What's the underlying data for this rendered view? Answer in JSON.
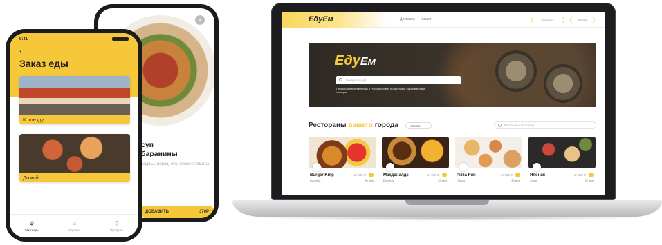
{
  "phone_front": {
    "time": "9:41",
    "back_glyph": "‹",
    "title": "Заказ еды",
    "tiles": [
      {
        "label": "К поезду"
      },
      {
        "label": "Домой"
      }
    ],
    "tabs": [
      {
        "icon": "fork-knife-icon",
        "glyph": "ψ",
        "label": "Заказ еды"
      },
      {
        "icon": "bag-icon",
        "glyph": "⌂",
        "label": "Корзина"
      },
      {
        "icon": "profile-icon",
        "glyph": "⚲",
        "label": "Профиль"
      }
    ]
  },
  "phone_back": {
    "close_glyph": "×",
    "dish_title": "суп\nбаранины",
    "dish_desc": "огурцы, перец, лук, спелые томаты",
    "add_label": "ДОБАВИТЬ",
    "add_price": "370Р"
  },
  "laptop": {
    "logo": "EдуЕм",
    "nav": [
      "Доставка",
      "Акции"
    ],
    "head_buttons": [
      "Корзина",
      "Войти"
    ],
    "hero": {
      "logo_main": "Eду",
      "logo_tail": "Ем",
      "search_placeholder": "Номер поезда",
      "subtitle": "Первый и единственный в России сервис по доставке еды к вагонам поездов"
    },
    "section": {
      "title_start": "Рестораны ",
      "title_accent": "вашего",
      "title_end": " города",
      "city": "Москва",
      "search_placeholder": "Ресторан или блюдо"
    },
    "restaurants": [
      {
        "name": "Burger King",
        "sub": "Бургеры",
        "price": "от 300 ₽",
        "time": "30 мин"
      },
      {
        "name": "Макдоналдс",
        "sub": "Бургеры",
        "price": "от 250 ₽",
        "time": "25 мин"
      },
      {
        "name": "Pizza Fun",
        "sub": "Пицца",
        "price": "от 400 ₽",
        "time": "40 мин"
      },
      {
        "name": "Японик",
        "sub": "Суши",
        "price": "от 350 ₽",
        "time": "35 мин"
      }
    ]
  },
  "colors": {
    "accent": "#f5c739",
    "dark": "#1b1b1b"
  }
}
